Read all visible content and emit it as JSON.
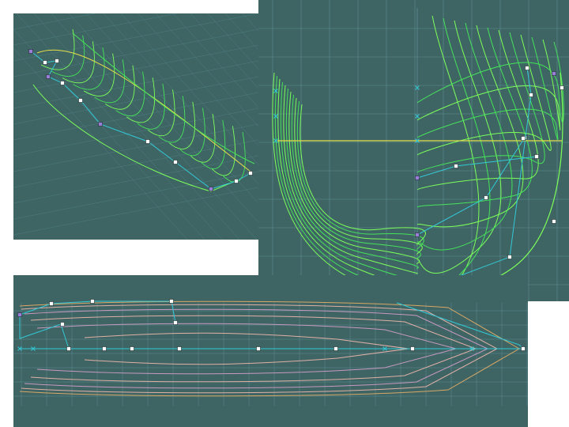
{
  "colors": {
    "background": "#ffffff",
    "viewport": "#3e6464",
    "grid": "#5f8f95",
    "grid_fine": "#4f7e80",
    "station_line": "#46e35a",
    "station_line_bright": "#7dff5a",
    "waterline": "#e6e04a",
    "control_polygon": "#33c9d6",
    "control_point_fill": "#ffffff",
    "control_point_selected": "#9a7dd6",
    "plan_outline": "#e0b0a6",
    "plan_outline_warm": "#d8a866",
    "plan_inner": "#c79ac0"
  },
  "icons": {
    "control_point": "square-handle",
    "vertex_marker": "x-cross"
  }
}
